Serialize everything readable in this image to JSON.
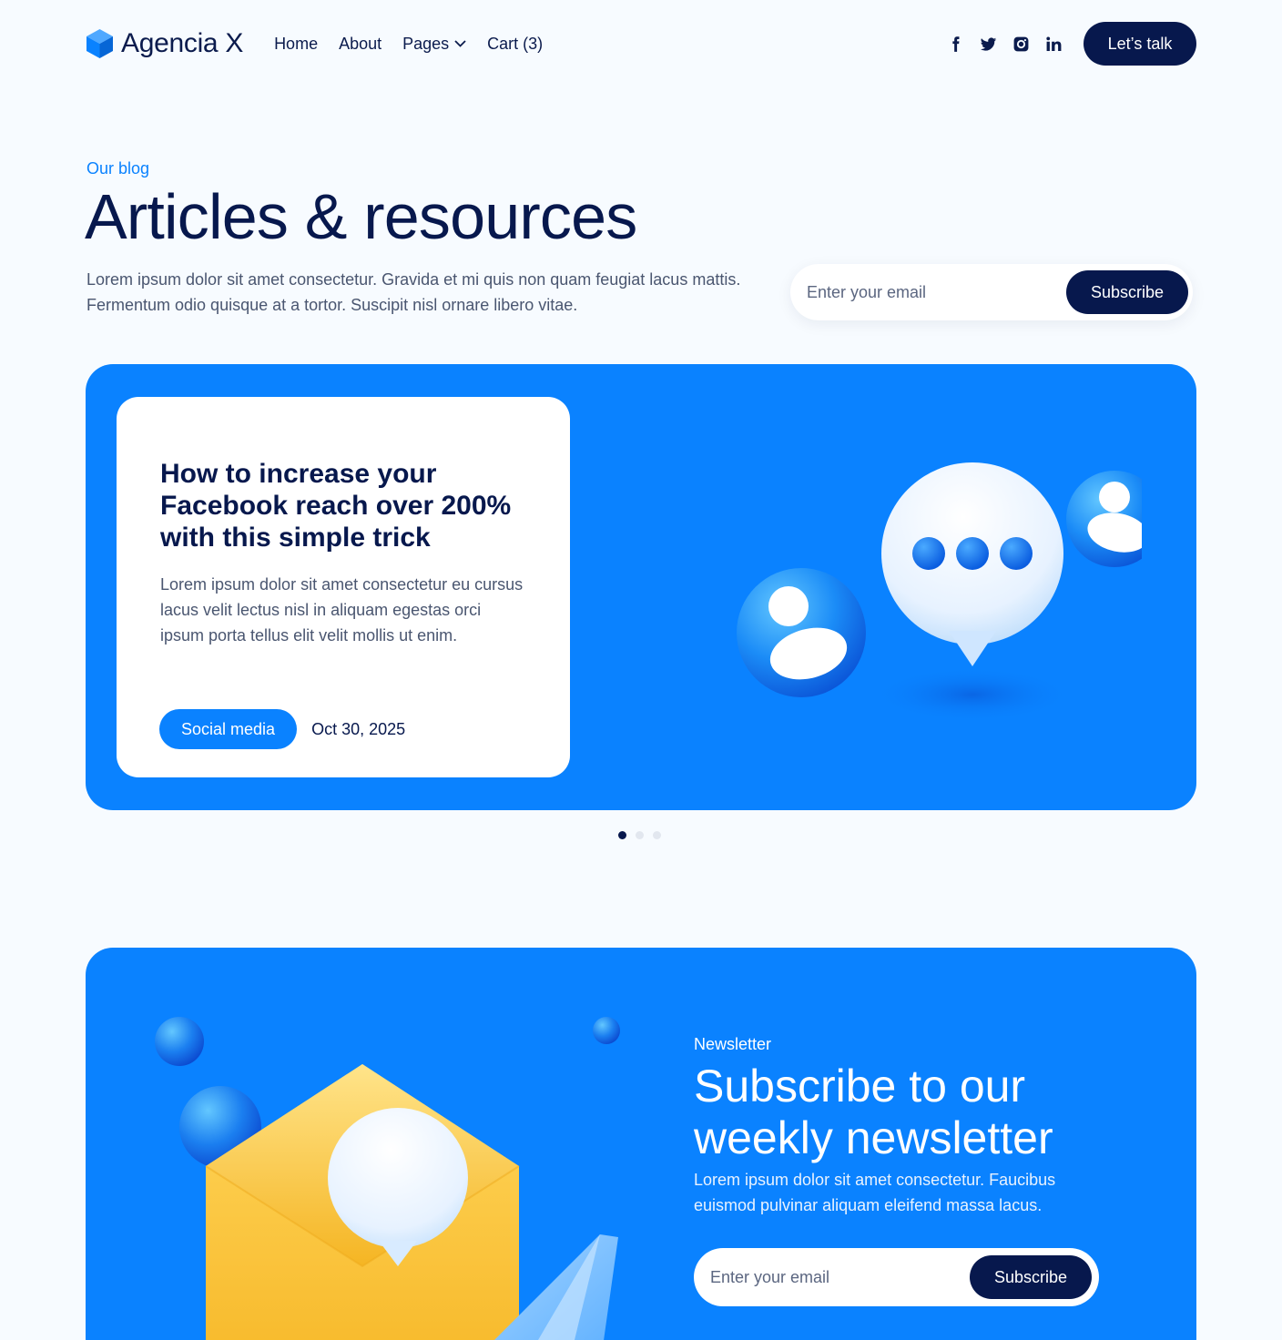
{
  "brand": {
    "name": "Agencia X",
    "color": "#0a82ff",
    "dark": "#07184d"
  },
  "nav": {
    "items": [
      {
        "label": "Home"
      },
      {
        "label": "About"
      },
      {
        "label": "Pages"
      },
      {
        "label": "Cart (3)"
      }
    ],
    "socials": [
      "facebook-icon",
      "twitter-icon",
      "instagram-icon",
      "linkedin-icon"
    ],
    "cta": "Let’s talk"
  },
  "hero": {
    "eyebrow": "Our blog",
    "title": "Articles & resources",
    "text": "Lorem ipsum dolor sit amet consectetur. Gravida et mi quis non quam feugiat lacus mattis. Fermentum odio quisque at a tortor. Suscipit nisl ornare libero vitae.",
    "email_placeholder": "Enter your email",
    "subscribe": "Subscribe"
  },
  "featured": {
    "title": "How to increase your Facebook reach over 200% with this simple trick",
    "text": "Lorem ipsum dolor sit amet consectetur eu cursus lacus velit lectus nisl in aliquam egestas orci ipsum porta tellus elit velit mollis ut enim.",
    "tag": "Social media",
    "date": "Oct 30, 2025"
  },
  "carousel": {
    "count": 3,
    "active": 1
  },
  "newsletter": {
    "eyebrow": "Newsletter",
    "title": "Subscribe to our weekly newsletter",
    "text": "Lorem ipsum dolor sit amet consectetur. Faucibus euismod pulvinar aliquam eleifend massa lacus.",
    "email_placeholder": "Enter your email",
    "subscribe": "Subscribe"
  }
}
